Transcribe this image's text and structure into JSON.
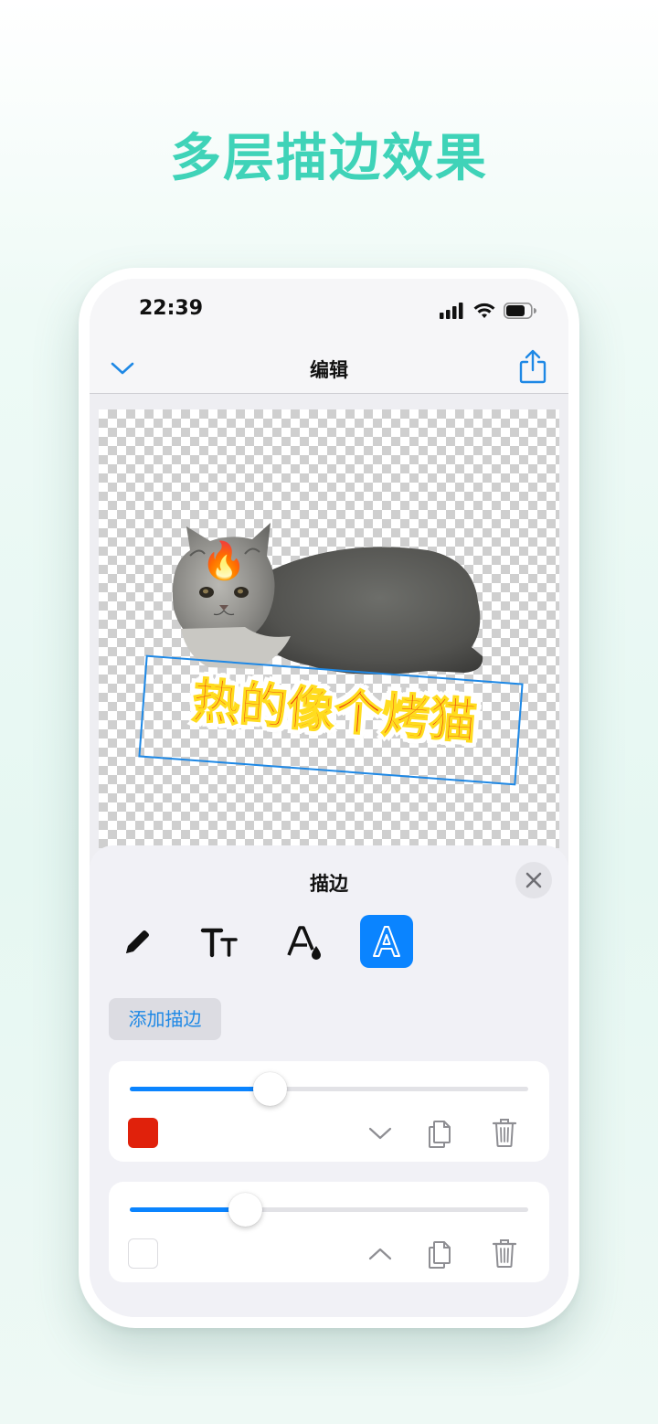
{
  "promo": {
    "title": "多层描边效果"
  },
  "status_bar": {
    "time": "22:39"
  },
  "nav": {
    "title": "编辑",
    "collapse_icon": "chevron-down-icon",
    "share_icon": "share-icon"
  },
  "canvas": {
    "sticker_text": "热的像个烤猫",
    "emoji": "🔥",
    "text_fill_color": "#e8280f",
    "text_inner_stroke": "#ffdc1e",
    "text_outer_stroke": "#ffffff"
  },
  "panel": {
    "title": "描边",
    "close_icon": "close-icon",
    "tools": [
      {
        "name": "pencil-icon",
        "selected": false
      },
      {
        "name": "text-size-icon",
        "selected": false
      },
      {
        "name": "text-color-icon",
        "selected": false
      },
      {
        "name": "text-stroke-icon",
        "selected": true
      }
    ],
    "add_stroke_label": "添加描边",
    "strokes": [
      {
        "width_fraction": 0.35,
        "color": "#e0210b",
        "expand_icon": "chevron-down-icon"
      },
      {
        "width_fraction": 0.29,
        "color": "#ffffff",
        "expand_icon": "chevron-up-icon"
      }
    ]
  },
  "colors": {
    "accent": "#0a84ff",
    "promo_title": "#3fd3b8"
  }
}
